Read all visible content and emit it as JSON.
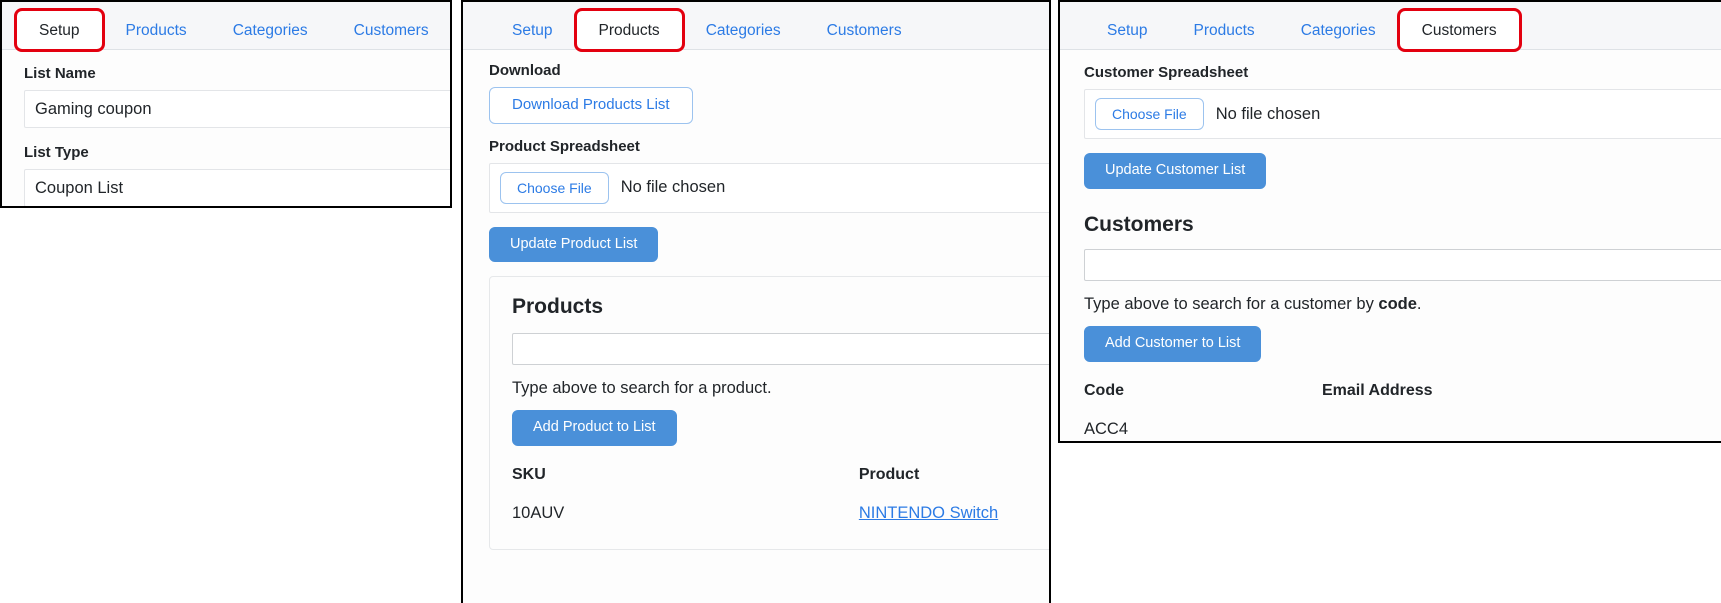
{
  "tabs": [
    "Setup",
    "Products",
    "Categories",
    "Customers"
  ],
  "panel_setup": {
    "active_tab": "Setup",
    "list_name_label": "List Name",
    "list_name_value": "Gaming coupon",
    "list_type_label": "List Type",
    "list_type_value": "Coupon List"
  },
  "panel_products": {
    "active_tab": "Products",
    "download_label": "Download",
    "download_button": "Download Products List",
    "spreadsheet_label": "Product Spreadsheet",
    "choose_file_button": "Choose File",
    "no_file_text": "No file chosen",
    "update_button": "Update Product List",
    "card_title": "Products",
    "search_value": "",
    "search_placeholder": "",
    "hint": "Type above to search for a product.",
    "add_button": "Add Product to List",
    "table": {
      "columns": [
        "SKU",
        "Product"
      ],
      "rows": [
        {
          "sku": "10AUV",
          "product": "NINTENDO Switch"
        }
      ]
    }
  },
  "panel_customers": {
    "active_tab": "Customers",
    "spreadsheet_label": "Customer Spreadsheet",
    "choose_file_button": "Choose File",
    "no_file_text": "No file chosen",
    "update_button": "Update Customer List",
    "card_title": "Customers",
    "search_value": "",
    "search_placeholder": "",
    "hint_prefix": "Type above to search for a customer by ",
    "hint_bold": "code",
    "hint_suffix": ".",
    "add_button": "Add Customer to List",
    "table": {
      "columns": [
        "Code",
        "Email Address"
      ],
      "rows": [
        {
          "code": "ACC4",
          "email": ""
        }
      ]
    }
  },
  "colors": {
    "highlight": "#e3000f",
    "link": "#2c7be5",
    "primary_button": "#4a90d9"
  }
}
